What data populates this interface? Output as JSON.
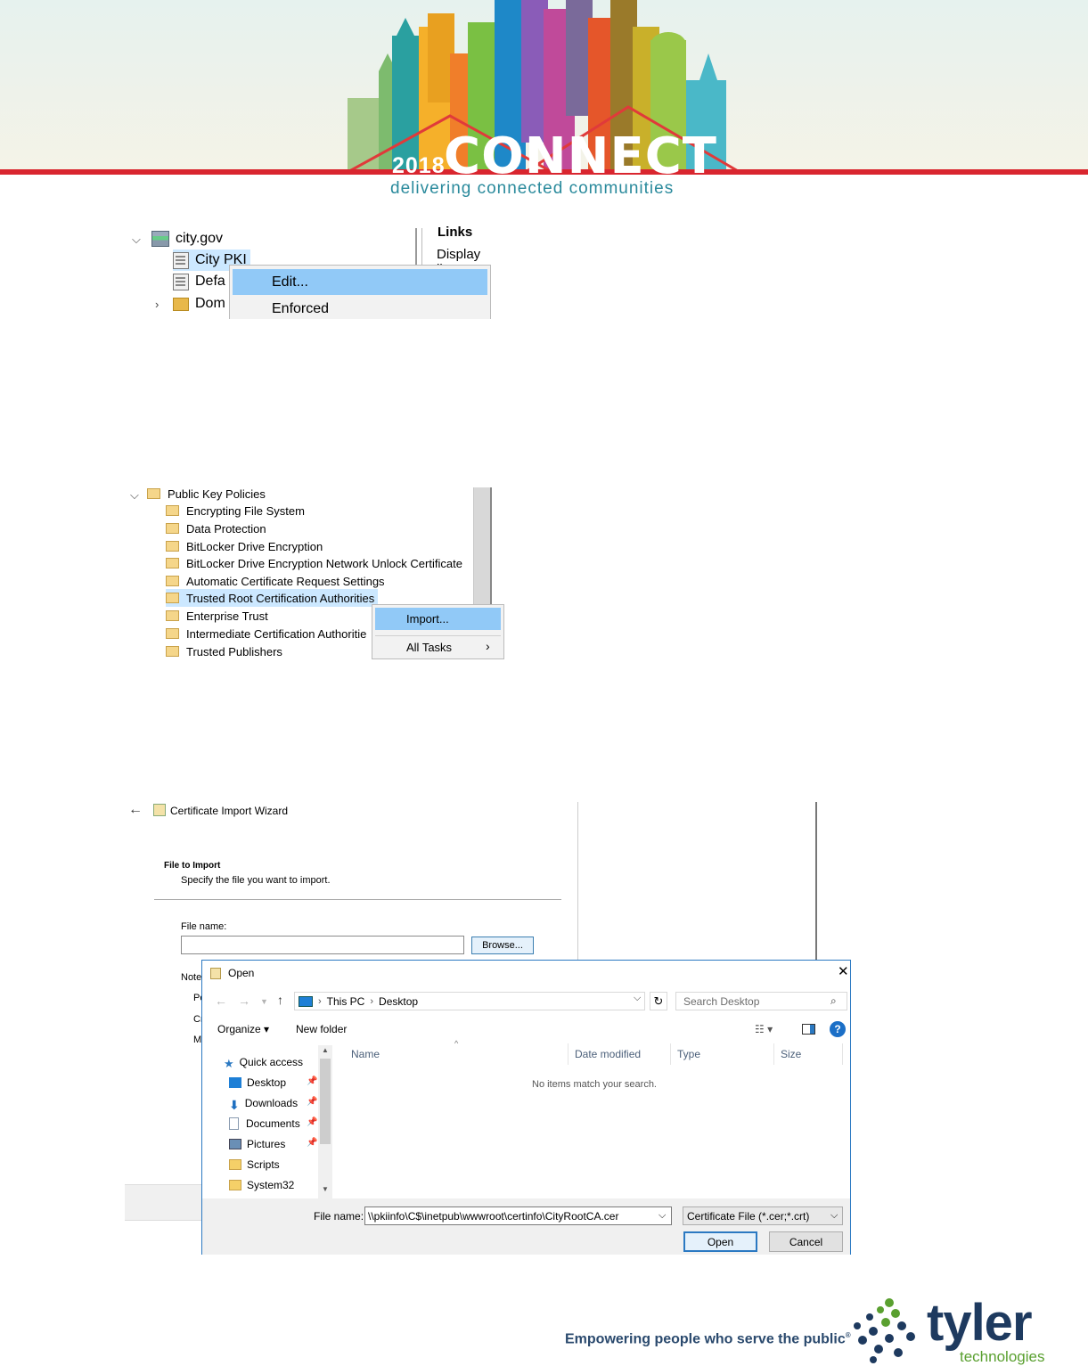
{
  "banner": {
    "year": "2018",
    "event": "CONNECT",
    "tagline": "delivering connected communities",
    "colors": {
      "red_line": "#d9262f",
      "teal": "#2a8a9c"
    }
  },
  "section1": {
    "tree": [
      {
        "label": "city.gov",
        "icon": "domain-icon",
        "expanded": true
      },
      {
        "label": "City PKI",
        "icon": "gpo-icon",
        "selected": true
      },
      {
        "label": "Defa",
        "icon": "gpo-icon"
      },
      {
        "label": "Dom",
        "icon": "ou-icon",
        "collapsed": true
      }
    ],
    "right_pane": {
      "header": "Links",
      "col1": "Display lin"
    },
    "context_menu": [
      {
        "label": "Edit...",
        "highlighted": true
      },
      {
        "label": "Enforced"
      }
    ]
  },
  "section2": {
    "root": "Public Key Policies",
    "items": [
      "Encrypting File System",
      "Data Protection",
      "BitLocker Drive Encryption",
      "BitLocker Drive Encryption Network Unlock Certificate",
      "Automatic Certificate Request Settings",
      "Trusted Root Certification Authorities",
      "Enterprise Trust",
      "Intermediate Certification Authoritie",
      "Trusted Publishers"
    ],
    "selected_index": 5,
    "context_menu": [
      {
        "label": "Import...",
        "highlighted": true
      },
      {
        "label": "All Tasks",
        "submenu": true
      }
    ]
  },
  "wizard": {
    "title": "Certificate Import Wizard",
    "heading": "File to Import",
    "subheading": "Specify the file you want to import.",
    "file_label": "File name:",
    "file_value": "",
    "browse_label": "Browse...",
    "note_fragment": "Note",
    "frag1": "Pe",
    "frag2": "Cr",
    "frag3": "M"
  },
  "open_dialog": {
    "title": "Open",
    "close": "✕",
    "breadcrumb": [
      "This PC",
      "Desktop"
    ],
    "search_placeholder": "Search Desktop",
    "toolbar": {
      "organize": "Organize ▾",
      "new_folder": "New folder"
    },
    "nav": [
      {
        "label": "Quick access",
        "icon": "star-icon",
        "pinned": false,
        "color": "#2b79c2"
      },
      {
        "label": "Desktop",
        "icon": "desktop-icon",
        "pinned": true,
        "color": "#1e7fd6"
      },
      {
        "label": "Downloads",
        "icon": "download-icon",
        "pinned": true,
        "color": "#1e6fc0"
      },
      {
        "label": "Documents",
        "icon": "document-icon",
        "pinned": true,
        "color": "#8a9bb0"
      },
      {
        "label": "Pictures",
        "icon": "pictures-icon",
        "pinned": true,
        "color": "#6a8fb5"
      },
      {
        "label": "Scripts",
        "icon": "folder-icon",
        "pinned": false,
        "color": "#f5d068"
      },
      {
        "label": "System32",
        "icon": "folder-icon",
        "pinned": false,
        "color": "#f5d068"
      }
    ],
    "columns": [
      "Name",
      "Date modified",
      "Type",
      "Size"
    ],
    "empty_message": "No items match your search.",
    "file_name_label": "File name:",
    "file_name_value": "\\\\pkiinfo\\C$\\inetpub\\wwwroot\\certinfo\\CityRootCA.cer",
    "file_type": "Certificate File (*.cer;*.crt)",
    "open_label": "Open",
    "cancel_label": "Cancel"
  },
  "footer": {
    "tagline": "Empowering people who serve the public",
    "reg": "®",
    "brand": "tyler",
    "brand_sub": "technologies",
    "colors": {
      "navy": "#1e3a5f",
      "green": "#5aa030"
    }
  }
}
